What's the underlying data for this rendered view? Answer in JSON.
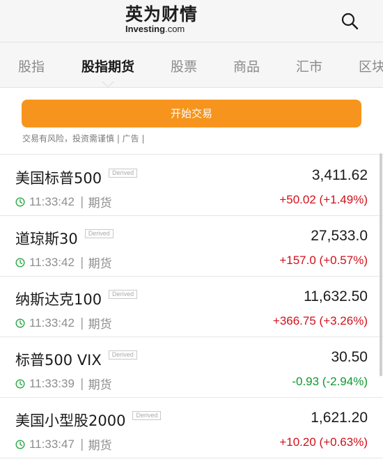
{
  "header": {
    "logo_cn": "英为财情",
    "logo_en_bold": "Investing",
    "logo_en_suffix": ".com"
  },
  "tabs": [
    {
      "label": "股指",
      "active": false
    },
    {
      "label": "股指期货",
      "active": true
    },
    {
      "label": "股票",
      "active": false
    },
    {
      "label": "商品",
      "active": false
    },
    {
      "label": "汇市",
      "active": false
    },
    {
      "label": "区块",
      "active": false
    }
  ],
  "ad": {
    "button_label": "开始交易",
    "disclaimer": "交易有风险，投资需谨慎 | 广告 |"
  },
  "colors": {
    "accent": "#f7941d",
    "up": "#d0101a",
    "down": "#0c9a2e",
    "clock": "#2aa845"
  },
  "rows": [
    {
      "name": "美国标普500",
      "badge": "Derived",
      "price": "3,411.62",
      "time": "11:33:42",
      "type": "期货",
      "change": "+50.02 (+1.49%)",
      "direction": "up"
    },
    {
      "name": "道琼斯30",
      "badge": "Derived",
      "price": "27,533.0",
      "time": "11:33:42",
      "type": "期货",
      "change": "+157.0 (+0.57%)",
      "direction": "up"
    },
    {
      "name": "纳斯达克100",
      "badge": "Derived",
      "price": "11,632.50",
      "time": "11:33:42",
      "type": "期货",
      "change": "+366.75 (+3.26%)",
      "direction": "up"
    },
    {
      "name": "标普500 VIX",
      "badge": "Derived",
      "price": "30.50",
      "time": "11:33:39",
      "type": "期货",
      "change": "-0.93 (-2.94%)",
      "direction": "down"
    },
    {
      "name": "美国小型股2000",
      "badge": "Derived",
      "price": "1,621.20",
      "time": "11:33:47",
      "type": "期货",
      "change": "+10.20 (+0.63%)",
      "direction": "up"
    }
  ]
}
